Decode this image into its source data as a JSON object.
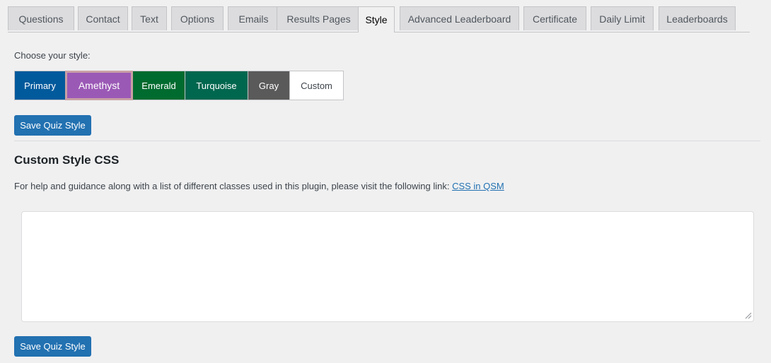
{
  "tabs": [
    {
      "label": "Questions",
      "active": false
    },
    {
      "label": "Contact",
      "active": false
    },
    {
      "label": "Text",
      "active": false
    },
    {
      "label": "Options",
      "active": false
    },
    {
      "label": "Emails",
      "active": false
    },
    {
      "label": "Results Pages",
      "active": false
    },
    {
      "label": "Style",
      "active": true
    },
    {
      "label": "Advanced Leaderboard",
      "active": false
    },
    {
      "label": "Certificate",
      "active": false
    },
    {
      "label": "Daily Limit",
      "active": false
    },
    {
      "label": "Leaderboards",
      "active": false
    }
  ],
  "style": {
    "choose_label": "Choose your style:",
    "options": [
      {
        "label": "Primary",
        "color": "#005a9c",
        "text_color": "#ffffff"
      },
      {
        "label": "Amethyst",
        "color": "#9b59b6",
        "text_color": "#ffffff",
        "selected": true
      },
      {
        "label": "Emerald",
        "color": "#006b2f",
        "text_color": "#ffffff"
      },
      {
        "label": "Turquoise",
        "color": "#00674f",
        "text_color": "#ffffff"
      },
      {
        "label": "Gray",
        "color": "#5a5a5a",
        "text_color": "#ffffff"
      },
      {
        "label": "Custom",
        "color": "#ffffff",
        "text_color": "#3c434a"
      }
    ],
    "save_label": "Save Quiz Style"
  },
  "custom_css": {
    "title": "Custom Style CSS",
    "help_text": "For help and guidance along with a list of different classes used in this plugin, please visit the following link: ",
    "help_link": "CSS in QSM",
    "value": "",
    "save_label": "Save Quiz Style"
  },
  "colors": {
    "accent": "#2271b1",
    "background": "#f0f0f1"
  }
}
